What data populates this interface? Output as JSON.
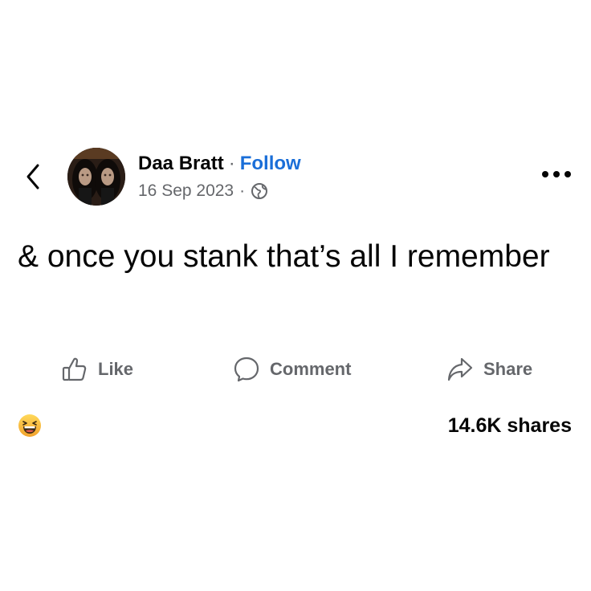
{
  "post": {
    "author": "Daa Bratt",
    "separator": "·",
    "follow_label": "Follow",
    "date": "16 Sep 2023",
    "privacy_icon": "globe-icon",
    "text": "& once you stank that’s all I remember"
  },
  "actions": {
    "like": "Like",
    "comment": "Comment",
    "share": "Share"
  },
  "stats": {
    "reaction_icon": "laughing-emoji-icon",
    "shares": "14.6K shares"
  },
  "colors": {
    "follow": "#1a6ed8",
    "muted": "#65676b",
    "text": "#050505"
  }
}
